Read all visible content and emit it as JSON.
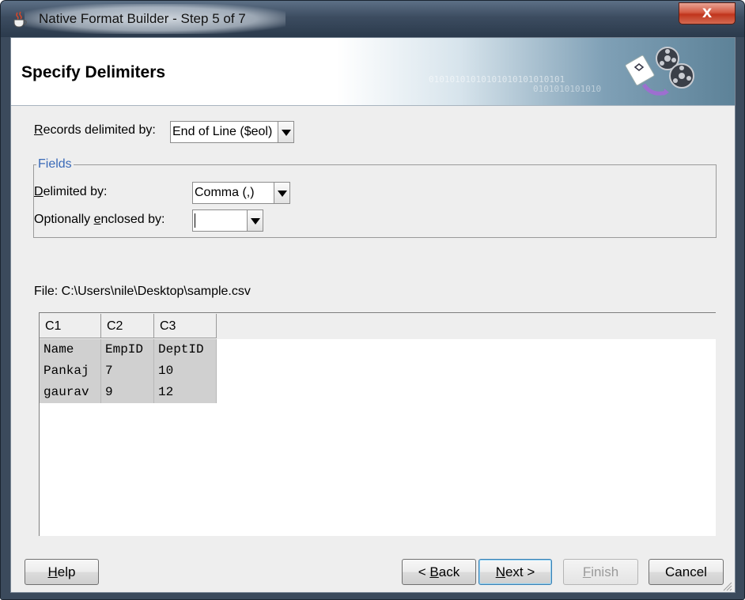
{
  "window": {
    "title": "Native Format Builder - Step 5 of 7",
    "close_glyph": "X"
  },
  "header": {
    "title": "Specify Delimiters",
    "binary_line1": "01010101010101010101010101",
    "binary_line2": "0101010101010"
  },
  "records": {
    "label_pre": "",
    "label_mnemonic": "R",
    "label_post": "ecords delimited by:",
    "value": "End of Line ($eol)"
  },
  "fields": {
    "legend": "Fields",
    "delimited_mnemonic": "D",
    "delimited_post": "elimited by:",
    "delimited_value": "Comma (,)",
    "enclosed_pre": "Optionally ",
    "enclosed_mnemonic": "e",
    "enclosed_post": "nclosed by:",
    "enclosed_value": ""
  },
  "file": {
    "label": "File: C:\\Users\\nile\\Desktop\\sample.csv"
  },
  "grid": {
    "columns": [
      "C1",
      "C2",
      "C3"
    ],
    "rows": [
      [
        "Name",
        "EmpID",
        "DeptID"
      ],
      [
        "Pankaj",
        "7",
        "10"
      ],
      [
        "gaurav",
        "9",
        "12"
      ]
    ]
  },
  "buttons": {
    "help_mnemonic": "H",
    "help_post": "elp",
    "back_pre": "< ",
    "back_mnemonic": "B",
    "back_post": "ack",
    "next_mnemonic": "N",
    "next_post": "ext >",
    "finish_mnemonic": "F",
    "finish_post": "inish",
    "cancel": "Cancel"
  },
  "colors": {
    "accent": "#3a6ab8",
    "close_red": "#c0351c",
    "cell_gray": "#d0d0d0"
  }
}
